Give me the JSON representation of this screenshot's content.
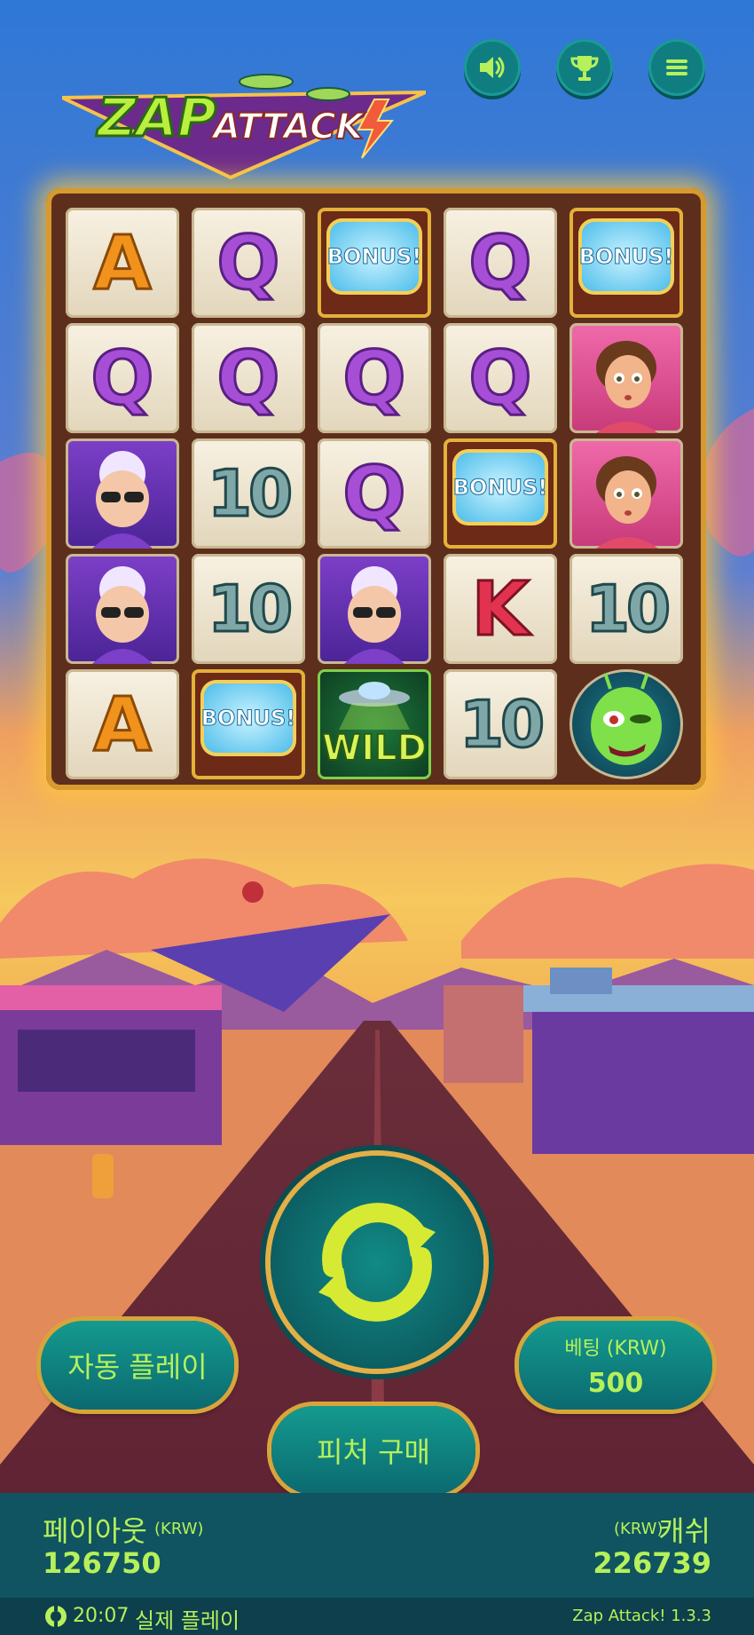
{
  "top_buttons": [
    {
      "icon": "speaker-icon"
    },
    {
      "icon": "trophy-icon"
    },
    {
      "icon": "hamburger-menu-icon"
    }
  ],
  "logo": {
    "word1": "ZAP",
    "word2": "ATTACK"
  },
  "reels": [
    [
      "A",
      "Q",
      "BONUS",
      "Q",
      "BONUS"
    ],
    [
      "Q",
      "Q",
      "Q",
      "Q",
      "GIRL"
    ],
    [
      "GRANNY",
      "10",
      "Q",
      "BONUS",
      "GIRL"
    ],
    [
      "GRANNY",
      "10",
      "GRANNY",
      "K",
      "10"
    ],
    [
      "A",
      "BONUS",
      "WILD",
      "10",
      "ALIEN"
    ]
  ],
  "symbol_text": {
    "bonus": "BONUS!",
    "wild": "WILD"
  },
  "controls": {
    "autoplay_label": "자동 플레이",
    "buy_feature_label": "피처 구매",
    "bet_label": "베팅 (KRW)",
    "bet_value": "500",
    "spin_icon": "refresh-icon"
  },
  "footer": {
    "payout_label": "페이아웃",
    "payout_currency": "(KRW)",
    "payout_value": "126750",
    "cash_currency": "(KRW)",
    "cash_label": "캐쉬",
    "cash_value": "226739"
  },
  "status": {
    "time": "20:07",
    "mode": "실제 플레이",
    "version": "Zap Attack! 1.3.3",
    "icon": "casino-chip-icon"
  },
  "colors": {
    "accent_green": "#b6f05a",
    "button_teal": "#107e80",
    "gold_border": "#d8a53a",
    "footer_bg": "#0f5460"
  }
}
